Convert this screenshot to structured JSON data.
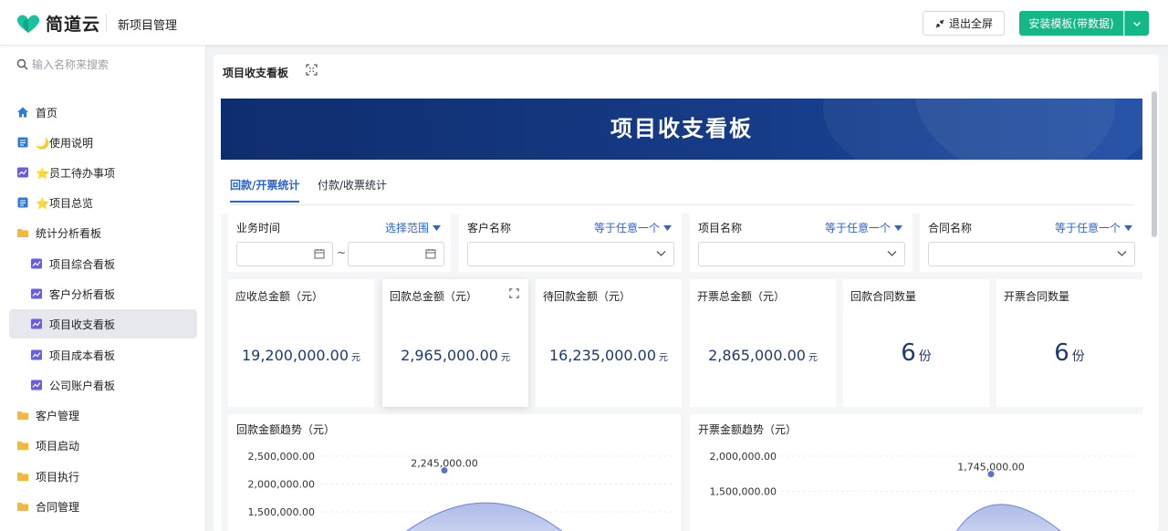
{
  "topbar": {
    "logo_text": "简道云",
    "app_title": "新项目管理",
    "exit_fullscreen": "退出全屏",
    "install_template": "安装模板(带数据)"
  },
  "sidebar": {
    "search_placeholder": "输入名称来搜索",
    "items": [
      {
        "label": "首页",
        "icon": "home-icon"
      },
      {
        "label": "🌙使用说明",
        "icon": "doc-icon"
      },
      {
        "label": "⭐员工待办事项",
        "icon": "dashboard-icon"
      },
      {
        "label": "⭐项目总览",
        "icon": "doc-icon"
      },
      {
        "label": "统计分析看板",
        "icon": "folder-icon"
      },
      {
        "label": "项目综合看板",
        "icon": "dashboard-icon"
      },
      {
        "label": "客户分析看板",
        "icon": "dashboard-icon"
      },
      {
        "label": "项目收支看板",
        "icon": "dashboard-icon",
        "active": true
      },
      {
        "label": "项目成本看板",
        "icon": "dashboard-icon"
      },
      {
        "label": "公司账户看板",
        "icon": "dashboard-icon"
      },
      {
        "label": "客户管理",
        "icon": "folder-icon"
      },
      {
        "label": "项目启动",
        "icon": "folder-icon"
      },
      {
        "label": "项目执行",
        "icon": "folder-icon"
      },
      {
        "label": "合同管理",
        "icon": "folder-icon"
      },
      {
        "label": "项目收支",
        "icon": "folder-icon"
      }
    ]
  },
  "page": {
    "title": "项目收支看板",
    "banner_title": "项目收支看板"
  },
  "tabs": [
    {
      "label": "回款/开票统计",
      "active": true
    },
    {
      "label": "付款/收票统计",
      "active": false
    }
  ],
  "filters": [
    {
      "label": "业务时间",
      "mode": "选择范围",
      "tilde": "~"
    },
    {
      "label": "客户名称",
      "mode": "等于任意一个"
    },
    {
      "label": "项目名称",
      "mode": "等于任意一个"
    },
    {
      "label": "合同名称",
      "mode": "等于任意一个"
    }
  ],
  "kpis": [
    {
      "label": "应收总金额（元）",
      "value": "19,200,000.00",
      "unit": "元"
    },
    {
      "label": "回款总金额（元）",
      "value": "2,965,000.00",
      "unit": "元"
    },
    {
      "label": "待回款金额（元）",
      "value": "16,235,000.00",
      "unit": "元"
    },
    {
      "label": "开票总金额（元）",
      "value": "2,865,000.00",
      "unit": "元"
    },
    {
      "label": "回款合同数量",
      "value": "6",
      "unit": "份"
    },
    {
      "label": "开票合同数量",
      "value": "6",
      "unit": "份"
    }
  ],
  "colors": {
    "brand": "#13b886",
    "accent": "#2b64d8",
    "banner": "#163b86",
    "kpi_value": "#1e3a72",
    "area_fill": "#aab8e6",
    "area_stroke": "#6f86d6"
  },
  "chart_data": [
    {
      "type": "area",
      "title": "回款金额趋势（元）",
      "yticks": [
        "2,500,000.00",
        "2,000,000.00",
        "1,500,000.00"
      ],
      "ylim": [
        1500000,
        2500000
      ],
      "series": [
        {
          "values": [
            2245000
          ]
        }
      ],
      "data_labels": [
        "2,245,000.00"
      ],
      "grid": true
    },
    {
      "type": "area",
      "title": "开票金额趋势（元）",
      "yticks": [
        "2,000,000.00",
        "1,500,000.00"
      ],
      "ylim": [
        1500000,
        2000000
      ],
      "series": [
        {
          "values": [
            1745000
          ]
        }
      ],
      "data_labels": [
        "1,745,000.00"
      ],
      "grid": true
    }
  ]
}
